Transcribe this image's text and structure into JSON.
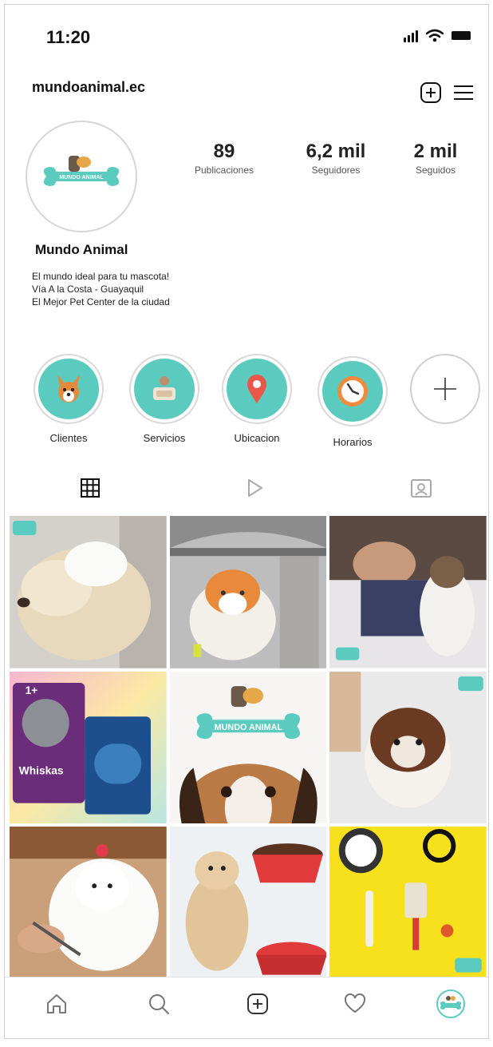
{
  "status_bar": {
    "time": "11:20"
  },
  "header": {
    "username": "mundoanimal.ec"
  },
  "profile": {
    "logo_text": "MUNDO ANIMAL",
    "stats": [
      {
        "value": "89",
        "label": "Publicaciones"
      },
      {
        "value": "6,2 mil",
        "label": "Seguidores"
      },
      {
        "value": "2 mil",
        "label": "Seguidos"
      }
    ],
    "display_name": "Mundo Animal",
    "bio": [
      "El mundo ideal para tu mascota!",
      "Vía A la Costa - Guayaquil",
      "El Mejor Pet Center de la ciudad"
    ]
  },
  "highlights": [
    {
      "label": "Clientes",
      "icon": "dog-face-icon"
    },
    {
      "label": "Servicios",
      "icon": "pet-bed-icon"
    },
    {
      "label": "Ubicacion",
      "icon": "location-pin-icon"
    },
    {
      "label": "Horarios",
      "icon": "clock-icon"
    }
  ],
  "grid_posts": [
    {
      "description": "dog-bath"
    },
    {
      "description": "cat-in-carrier"
    },
    {
      "description": "cat-grooming"
    },
    {
      "description": "cat-food-whiskas",
      "text": [
        "1+",
        "Whiskas"
      ]
    },
    {
      "description": "logo-dog-peeking",
      "text": [
        "MUNDO ANIMAL"
      ]
    },
    {
      "description": "shih-tzu-bath"
    },
    {
      "description": "maltese-grooming"
    },
    {
      "description": "puppy-bowls"
    },
    {
      "description": "pet-accessories-yellow"
    }
  ],
  "colors": {
    "accent": "#5ccbbf",
    "pin": "#e8574a",
    "clock": "#f28a3c"
  }
}
